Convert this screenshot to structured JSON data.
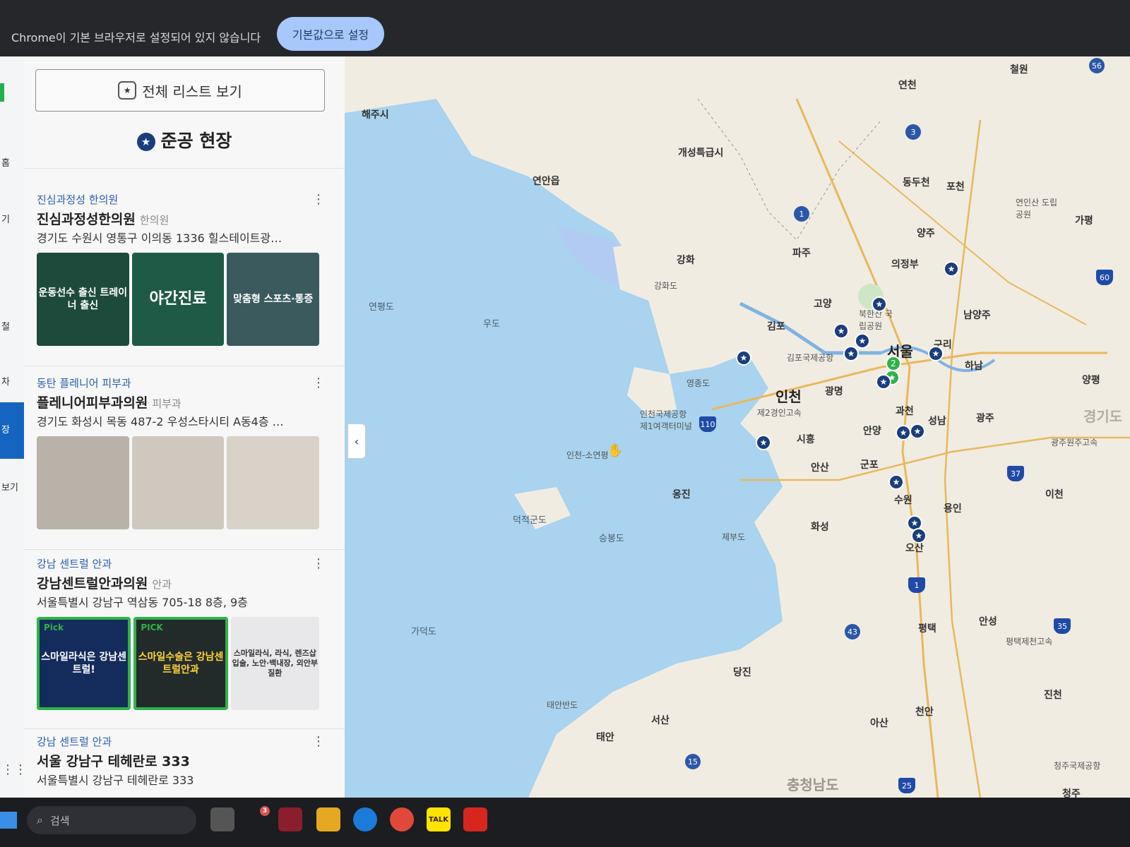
{
  "infobar": {
    "message": "Chrome이 기본 브라우저로 설정되어 있지 않습니다",
    "button": "기본값으로 설정"
  },
  "rail": {
    "items": [
      "홈",
      "기",
      "철",
      "차",
      "장",
      "보기"
    ],
    "active": "장"
  },
  "panel": {
    "list_button": "전체 리스트 보기",
    "section_title": "준공 현장",
    "collapse_icon": "chevron-left-icon",
    "cards": [
      {
        "category": "진심과정성 한의원",
        "name": "진심과정성한의원",
        "type": "한의원",
        "address": "경기도 수원시 영통구 이의동 1336 힐스테이트광…",
        "thumbs": [
          "운동선수 출신 트레이너 출신",
          "야간진료",
          "맞춤형 스포츠·통증"
        ]
      },
      {
        "category": "동탄 플레니어 피부과",
        "name": "플레니어피부과의원",
        "type": "피부과",
        "address": "경기도 화성시 목동 487-2 우성스타시티 A동4층 …",
        "thumbs": [
          "",
          "",
          ""
        ]
      },
      {
        "category": "강남 센트럴 안과",
        "name": "강남센트럴안과의원",
        "type": "안과",
        "address": "서울특별시 강남구 역삼동 705-18 8층, 9층",
        "thumbs": [
          "스마일라식은 강남센트럴!",
          "스마일수술은 강남센트럴안과",
          "스마일라식, 라식, 렌즈삽입술, 노안·백내장, 외안부질환"
        ],
        "pick": [
          "Pick",
          "PICK"
        ]
      },
      {
        "category": "강남 센트럴 안과",
        "name": "서울 강남구 테헤란로 333",
        "type": "",
        "address": "서울특별시 강남구 테헤란로 333"
      }
    ]
  },
  "map": {
    "labels": {
      "cheorwon": "철원",
      "yeoncheon": "연천",
      "haeju": "해주시",
      "kaesong": "개성특급시",
      "yeonan": "연안읍",
      "dongducheon": "동두천",
      "pocheon": "포천",
      "yeonin": "연인산 도립공원",
      "gapyeong": "가평",
      "yangju": "양주",
      "paju": "파주",
      "ganghwa": "강화",
      "ganghwado": "강화도",
      "uijeongbu": "의정부",
      "namyangju": "남양주",
      "goyang": "고양",
      "bukhan": "북한산 국립공원",
      "yeonpyeong": "연평도",
      "udo": "우도",
      "gimpo": "김포",
      "gimpo_airport": "김포국제공항",
      "seoul": "서울",
      "guri": "구리",
      "hanam": "하남",
      "yangpyeong": "양평",
      "yeongjong": "영종도",
      "incheon": "인천",
      "gwangmyeong": "광명",
      "incheon_airport": "인천국제공항 제1여객터미널",
      "second_gyeongin": "제2경인고속",
      "gwacheon": "과천",
      "seongnam": "성남",
      "gwangju": "광주",
      "gyeonggi": "경기도",
      "siheung": "시흥",
      "anyang": "안양",
      "gunpo": "군포",
      "ansan": "안산",
      "incheon_route": "인천-소연평",
      "suwon": "수원",
      "yongin": "용인",
      "icheon": "이천",
      "ongjin": "옹진",
      "deokjeok": "덕적군도",
      "seungbong": "승봉도",
      "jebu": "제부도",
      "hwaseong": "화성",
      "osan": "오산",
      "gadeok": "가덕도",
      "pyeongtaek": "평택",
      "anseong": "안성",
      "dangjin": "당진",
      "taean_peninsula": "태안반도",
      "seosan": "서산",
      "taean": "태안",
      "asan": "아산",
      "cheonan": "천안",
      "jincheon": "진천",
      "chungnam": "충청남도",
      "cheongju_airport": "청주국제공항",
      "cheongju": "청주",
      "pyeongtaek_jecheon": "평택제천고속",
      "gwangju_wonju": "광주원주고속"
    },
    "route_shields": [
      "56",
      "3",
      "1",
      "60",
      "110",
      "37",
      "1",
      "35",
      "43",
      "15",
      "25"
    ],
    "cluster_count": "2",
    "cursor": "hand-cursor-icon"
  },
  "taskbar": {
    "search_placeholder": "검색",
    "badge": "3",
    "kakao": "TALK"
  },
  "colors": {
    "accent": "#1a3d7c",
    "link": "#2a5db0",
    "pick_green": "#2fb24a",
    "sea": "#a9d3ee",
    "land": "#f1ece2"
  }
}
